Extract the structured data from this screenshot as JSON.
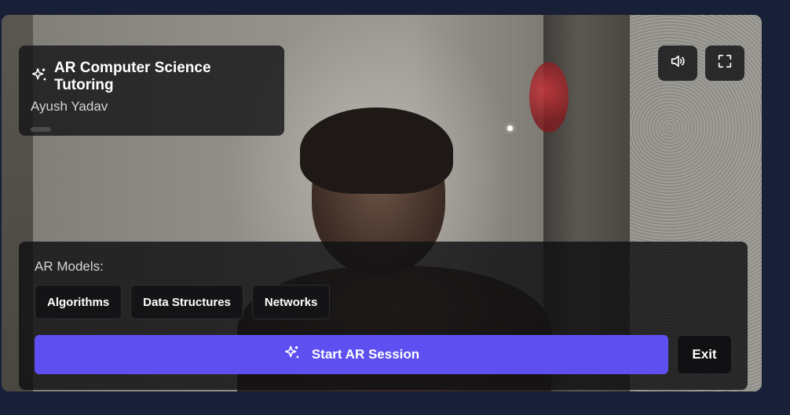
{
  "header": {
    "title": "AR Computer Science Tutoring",
    "user_name": "Ayush Yadav",
    "icon": "sparkles-icon"
  },
  "controls": {
    "volume_icon": "volume-icon",
    "fullscreen_icon": "fullscreen-icon"
  },
  "models": {
    "label": "AR Models:",
    "items": [
      "Algorithms",
      "Data Structures",
      "Networks"
    ]
  },
  "actions": {
    "start_label": "Start AR Session",
    "start_icon": "sparkles-icon",
    "exit_label": "Exit"
  },
  "colors": {
    "background": "#172036",
    "accent": "#5d4ff0"
  }
}
